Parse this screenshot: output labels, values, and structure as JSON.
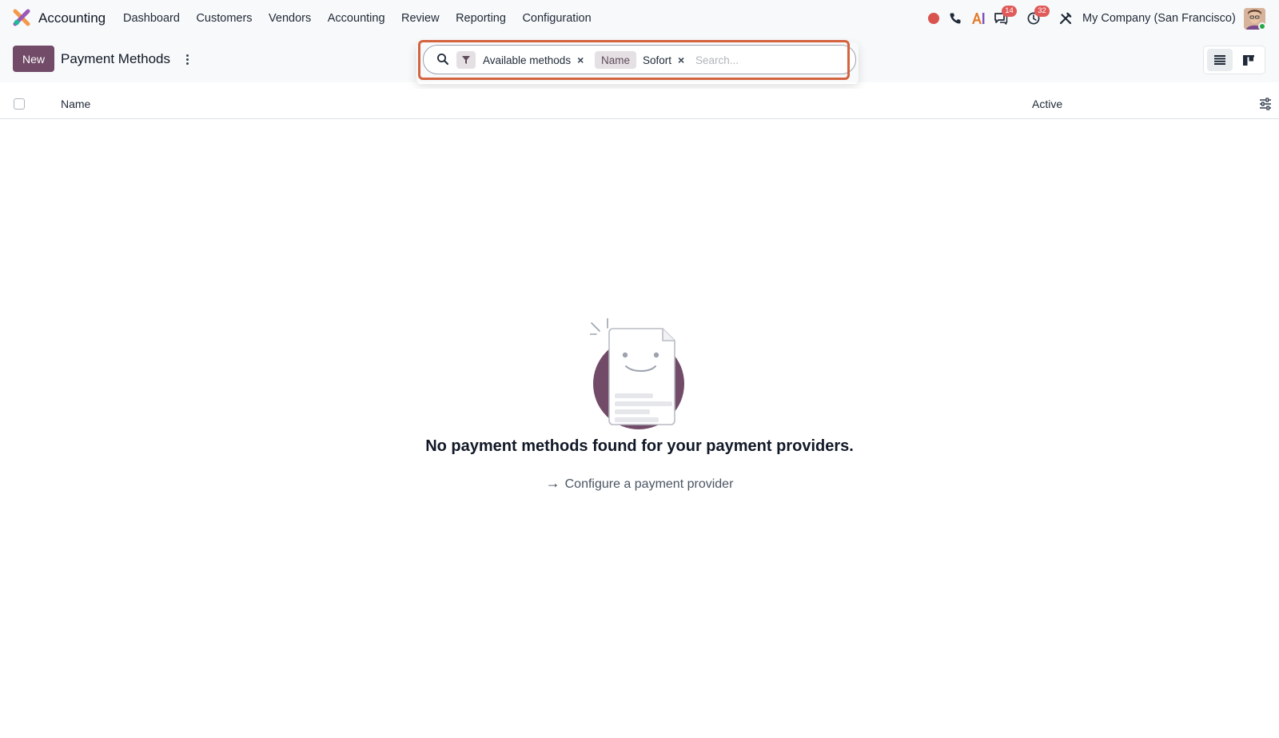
{
  "navbar": {
    "app_name": "Accounting",
    "menu": [
      "Dashboard",
      "Customers",
      "Vendors",
      "Accounting",
      "Review",
      "Reporting",
      "Configuration"
    ],
    "messages_count": "14",
    "activities_count": "32",
    "company": "My Company (San Francisco)"
  },
  "control_panel": {
    "new_label": "New",
    "title": "Payment Methods"
  },
  "search": {
    "facets": [
      {
        "type": "filter",
        "value": "Available methods"
      },
      {
        "type": "field",
        "label": "Name",
        "value": "Sofort"
      }
    ],
    "placeholder": "Search..."
  },
  "list": {
    "columns": [
      "Name",
      "Active"
    ]
  },
  "empty_state": {
    "title": "No payment methods found for your payment providers.",
    "link_label": "Configure a payment provider"
  },
  "colors": {
    "brand": "#714b67",
    "highlight_border": "#d4633f",
    "badge": "#e05a5a",
    "record_dot": "#d9534f"
  }
}
